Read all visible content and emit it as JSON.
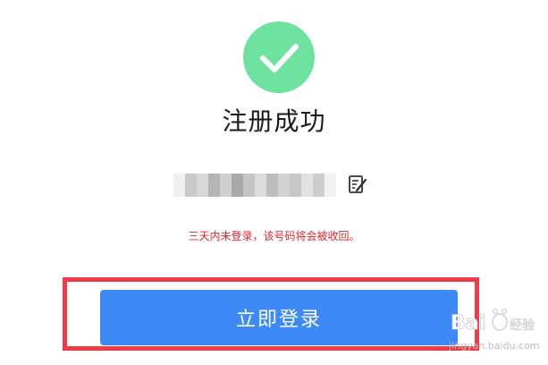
{
  "status": {
    "title": "注册成功",
    "icon": "checkmark-icon",
    "success_color": "#6ee3a0"
  },
  "account": {
    "edit_icon": "edit-icon"
  },
  "notice": {
    "warning_text": "三天内未登录，该号码将会被收回。",
    "warning_color": "#e0262d"
  },
  "actions": {
    "login_label": "立即登录",
    "button_color": "#3d8af7",
    "highlight_color": "#f03c48"
  },
  "watermark": {
    "brand": "Bai du 经验",
    "site": "jingyan.baidu.com"
  }
}
